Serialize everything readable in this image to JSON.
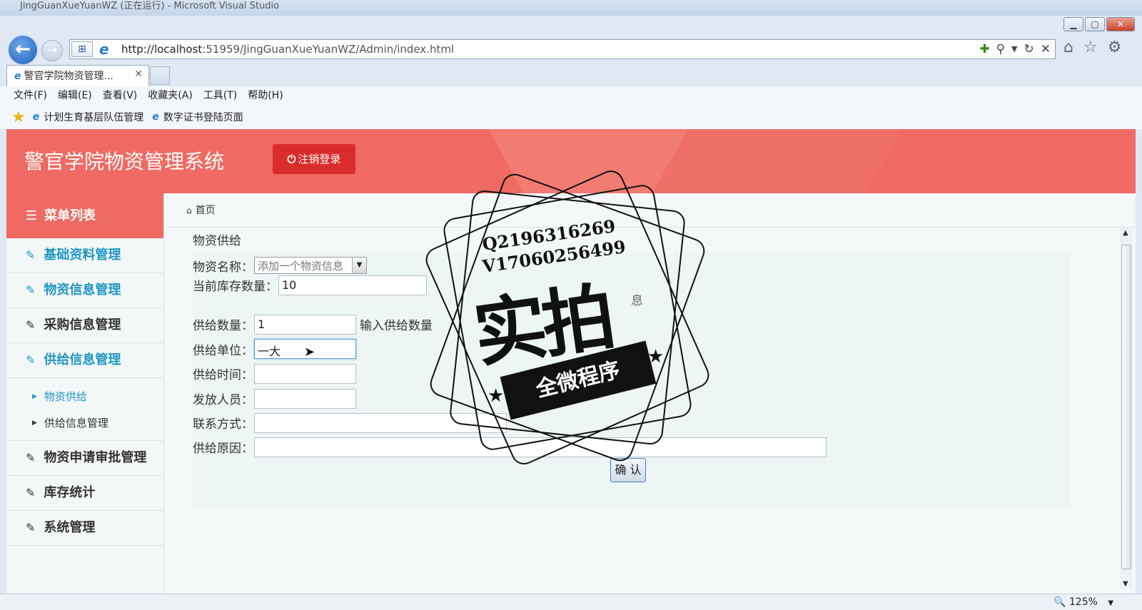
{
  "browser": {
    "window_title": "JingGuanXueYuanWZ (正在运行) - Microsoft Visual Studio",
    "url_host": "http://localhost",
    "url_rest": ":51959/JingGuanXueYuanWZ/Admin/index.html",
    "tab_title": "警官学院物资管理...",
    "menu": [
      "文件(F)",
      "编辑(E)",
      "查看(V)",
      "收藏夹(A)",
      "工具(T)",
      "帮助(H)"
    ],
    "favorites": [
      "计划生育基层队伍管理",
      "数字证书登陆页面"
    ],
    "zoom": "125%"
  },
  "header": {
    "site_title": "警官学院物资管理系统",
    "logout_label": "注销登录"
  },
  "sidebar": {
    "heading": "菜单列表",
    "items": [
      {
        "label": "基础资料管理"
      },
      {
        "label": "物资信息管理"
      },
      {
        "label": "采购信息管理"
      },
      {
        "label": "供给信息管理"
      },
      {
        "label": "物资申请审批管理"
      },
      {
        "label": "库存统计"
      },
      {
        "label": "系统管理"
      }
    ],
    "subitems": [
      {
        "label": "物资供给"
      },
      {
        "label": "供给信息管理"
      }
    ]
  },
  "breadcrumb": {
    "home": "首页"
  },
  "form": {
    "title": "物资供给",
    "name_label": "物资名称：",
    "name_selected": "添加一个物资信息",
    "stock_label": "当前库存数量：",
    "stock_value": "10",
    "qty_label": "供给数量：",
    "qty_value": "1",
    "qty_hint": "输入供给数量",
    "unit_label": "供给单位：",
    "unit_value": "一大",
    "time_label": "供给时间：",
    "time_value": "",
    "person_label": "发放人员：",
    "person_value": "",
    "contact_label": "联系方式：",
    "contact_value": "",
    "reason_label": "供给原因：",
    "reason_value": "",
    "partial_text": "息",
    "confirm_label": "确 认"
  },
  "watermark": {
    "line1": "Q2196316269",
    "line2": "V17060256499",
    "big_text": "实拍",
    "ribbon_text": "全微程序"
  }
}
